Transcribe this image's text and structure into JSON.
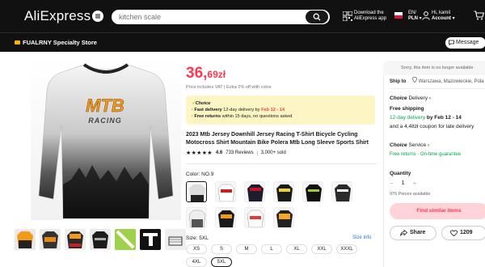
{
  "header": {
    "logo": "AliExpress",
    "search_placeholder": "kitchen scale",
    "download_line1": "Download the",
    "download_line2": "AliExpress app",
    "lang_line1": "EN/",
    "lang_line2": "PLN",
    "account_line1": "Hi, kamil",
    "account_line2": "Account"
  },
  "store": {
    "name": "FUALRNY Specialty Store",
    "message_label": "Message"
  },
  "product": {
    "price_int": "36,",
    "price_dec": "69zł",
    "price_note": "Price includes VAT | Extra 2% off with coins",
    "choice_tag": "Choice",
    "fast_prefix": "· Fast delivery",
    "fast_mid": " 12-day delivery by ",
    "fast_date": "Feb 12 - 14",
    "returns_prefix": "· Free returns",
    "returns_suffix": " within 15 days, no questions asked",
    "title": "2023 Mtb Jersey Downhill Jersey Racing T-Shirt Bicycle Cycling Motocross Shirt Mountain Bike Polera Mtb Long Sleeve Sports Shirt",
    "rating": "4.6",
    "reviews": "733 Reviews",
    "sold": "3,000+ sold",
    "color_label": "Color: NO.9",
    "size_label": "Size: 5XL",
    "size_info": "Size Info",
    "sizes": [
      "XS",
      "S",
      "M",
      "L",
      "XL",
      "XXL",
      "XXXL",
      "4XL",
      "5XL"
    ],
    "jersey_brand": "MTB",
    "jersey_sub": "RACING"
  },
  "panel": {
    "unavailable": "Sorry, this item is no longer available",
    "ship_to_label": "Ship to",
    "ship_to_location": "Warszawa, Mazowieckie, Pola",
    "choice_delivery_tag": "Choice",
    "choice_delivery": " Delivery",
    "free_shipping": "Free shipping",
    "delivery_prefix": "12-day delivery",
    "delivery_by": " by Feb 12 - 14",
    "coupon": "and a 4,48zł coupon for late delivery",
    "choice_service_tag": "Choice",
    "choice_service": " Service",
    "returns": "Free returns · On-time guarantee",
    "quantity_label": "Quantity",
    "quantity_value": "1",
    "quantity_note": "976 Pieces available",
    "similar_button": "Find similar items",
    "share_button": "Share",
    "wishlist_count": "1209"
  },
  "colors": {
    "accent": "#fd384f",
    "choice_bg": "#fdf5c4",
    "green": "#00a854",
    "header_bg": "#111111"
  }
}
